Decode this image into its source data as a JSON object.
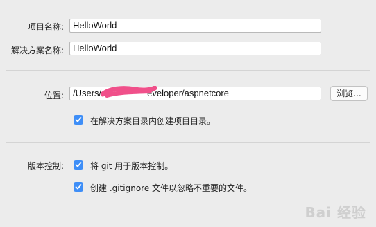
{
  "project": {
    "name_label": "项目名称:",
    "name_value": "HelloWorld"
  },
  "solution": {
    "name_label": "解决方案名称:",
    "name_value": "HelloWorld"
  },
  "location": {
    "label": "位置:",
    "path_prefix": "/Users/",
    "path_suffix": "eveloper/aspnetcore",
    "browse_label": "浏览..."
  },
  "options": {
    "create_in_solution_dir": {
      "label": "在解决方案目录内创建项目目录。",
      "checked": true
    }
  },
  "version_control": {
    "label": "版本控制:",
    "use_git": {
      "label": "将 git 用于版本控制。",
      "checked": true
    },
    "gitignore": {
      "label": "创建 .gitignore 文件以忽略不重要的文件。",
      "checked": true
    }
  },
  "watermark": "Bai 经验",
  "colors": {
    "checkbox": "#3e8ef7",
    "redaction": "#f0508a",
    "background": "#ececec"
  }
}
